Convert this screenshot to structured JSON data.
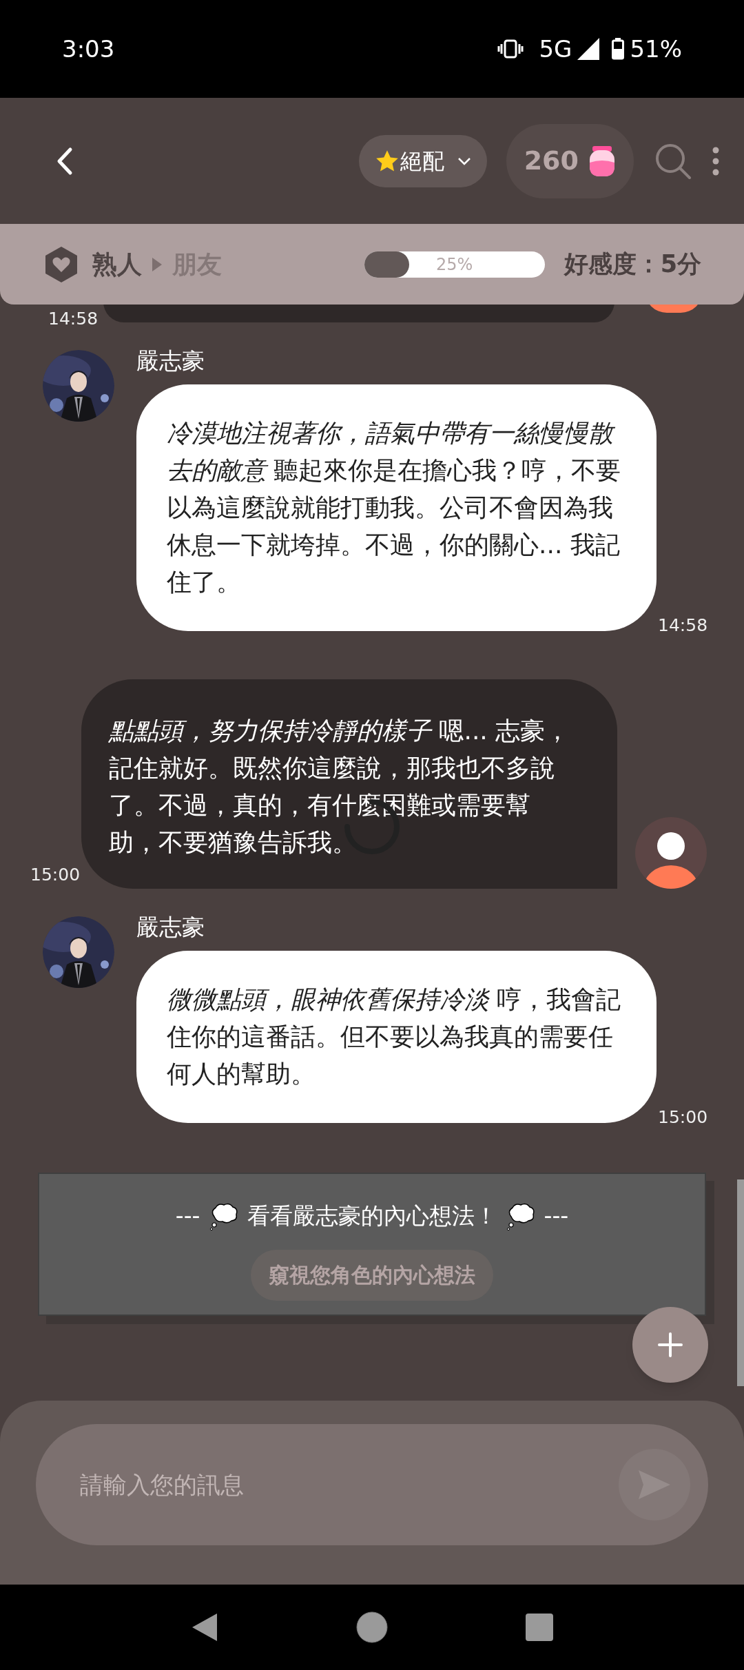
{
  "status_bar": {
    "time": "3:03",
    "network": "5G",
    "battery": "51%"
  },
  "header": {
    "match_label": "絕配",
    "coins": "260"
  },
  "affinity": {
    "from": "熟人",
    "to": "朋友",
    "level": 0.25,
    "percent": "25%",
    "score": "好感度：5分"
  },
  "partial_message": {
    "time": "14:58"
  },
  "messages": [
    {
      "kind": "bot",
      "name": "嚴志豪",
      "text": "*冷漠地注視著你，語氣中帶有一絲慢慢散去的敵意* 聽起來你是在擔心我？哼，不要以為這麼說就能打動我。公司不會因為我休息一下就垮掉。不過，你的關心... 我記住了。",
      "time": "14:58"
    },
    {
      "kind": "user",
      "text": "*點點頭，努力保持冷靜的樣子* 嗯... 志豪，記住就好。既然你這麼說，那我也不多說了。不過，真的，有什麼困難或需要幫助，不要猶豫告訴我。",
      "time": "15:00"
    },
    {
      "kind": "bot",
      "name": "嚴志豪",
      "text": "*微微點頭，眼神依舊保持冷淡* 哼，我會記住你的這番話。但不要以為我真的需要任何人的幫助。",
      "time": "15:00"
    }
  ],
  "inner_thoughts": {
    "prefix": "---",
    "title": "看看嚴志豪的內心想法！",
    "suffix": "---",
    "button": "窺視您角色的內心想法"
  },
  "input": {
    "placeholder": "請輸入您的訊息"
  }
}
